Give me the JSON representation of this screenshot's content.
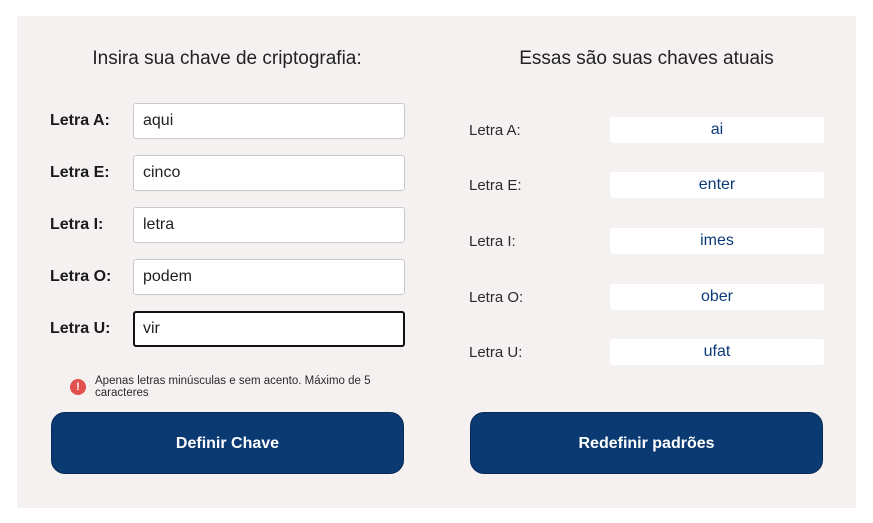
{
  "left": {
    "title": "Insira sua chave de criptografia:",
    "rows": [
      {
        "label": "Letra A:",
        "value": "aqui"
      },
      {
        "label": "Letra E:",
        "value": "cinco"
      },
      {
        "label": "Letra I:",
        "value": "letra"
      },
      {
        "label": "Letra O:",
        "value": "podem"
      },
      {
        "label": "Letra U:",
        "value": "vir"
      }
    ],
    "error": {
      "icon": "!",
      "text": "Apenas letras minúsculas e sem acento. Máximo de 5 caracteres"
    },
    "button_label": "Definir Chave"
  },
  "right": {
    "title": "Essas são suas chaves atuais",
    "rows": [
      {
        "label": "Letra A:",
        "value": "ai"
      },
      {
        "label": "Letra E:",
        "value": "enter"
      },
      {
        "label": "Letra I:",
        "value": "imes"
      },
      {
        "label": "Letra O:",
        "value": "ober"
      },
      {
        "label": "Letra U:",
        "value": "ufat"
      }
    ],
    "button_label": "Redefinir padrões"
  },
  "colors": {
    "panel_background": "#f5f1f0",
    "button_background": "#0b3a73",
    "error_icon": "#e25050",
    "key_value_text": "#0b3a78"
  }
}
